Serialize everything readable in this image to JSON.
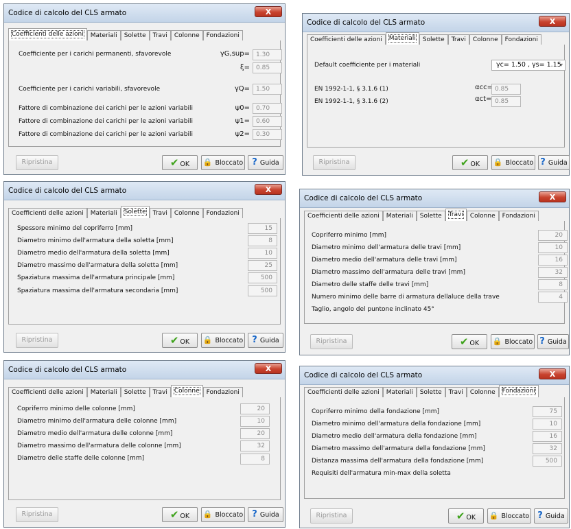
{
  "title": "Codice di calcolo del CLS armato",
  "tabs": [
    "Coefficienti delle azioni",
    "Materiali",
    "Solette",
    "Travi",
    "Colonne",
    "Fondazioni"
  ],
  "buttons": {
    "reset": "Ripristina",
    "ok": "OK",
    "locked": "Bloccato",
    "help": "Guida",
    "close": "X"
  },
  "azioni": {
    "rows": [
      {
        "label": "Coefficiente per i carichi permanenti, sfavorevole",
        "symbol": "γG,sup=",
        "value": "1.30"
      },
      {
        "label": "",
        "symbol": "ξ=",
        "value": "0.85"
      },
      {
        "label": "Coefficiente per i carichi variabili, sfavorevole",
        "symbol": "γQ=",
        "value": "1.50"
      },
      {
        "label": "Fattore di combinazione dei carichi per le azioni variabili",
        "symbol": "ψ0=",
        "value": "0.70"
      },
      {
        "label": "Fattore di combinazione dei carichi per le azioni variabili",
        "symbol": "ψ1=",
        "value": "0.60"
      },
      {
        "label": "Fattore di combinazione dei carichi per le azioni variabili",
        "symbol": "ψ2=",
        "value": "0.30"
      }
    ]
  },
  "materiali": {
    "default_label": "Default coefficiente per i materiali",
    "default_value": "γc= 1.50 , γs= 1.15",
    "rows": [
      {
        "label": "EN 1992-1-1, § 3.1.6 (1)",
        "symbol": "αcc=",
        "value": "0.85"
      },
      {
        "label": "EN 1992-1-1, § 3.1.6 (2)",
        "symbol": "αct=",
        "value": "0.85"
      }
    ]
  },
  "solette": {
    "rows": [
      {
        "label": "Spessore minimo del copriferro [mm]",
        "value": "15"
      },
      {
        "label": "Diametro minimo dell'armatura della soletta [mm]",
        "value": "8"
      },
      {
        "label": "Diametro medio dell'armatura della soletta [mm]",
        "value": "10"
      },
      {
        "label": "Diametro massimo dell'armatura della soletta [mm]",
        "value": "25"
      },
      {
        "label": "Spaziatura massima dell'armatura principale [mm]",
        "value": "500"
      },
      {
        "label": "Spaziatura massima dell'armatura secondaria [mm]",
        "value": "500"
      }
    ]
  },
  "travi": {
    "rows": [
      {
        "label": "Copriferro minimo [mm]",
        "value": "20"
      },
      {
        "label": "Diametro minimo dell'armatura delle travi [mm]",
        "value": "10"
      },
      {
        "label": "Diametro medio dell'armatura delle travi [mm]",
        "value": "16"
      },
      {
        "label": "Diametro massimo dell'armatura delle travi [mm]",
        "value": "32"
      },
      {
        "label": "Diametro delle staffe delle travi [mm]",
        "value": "8"
      },
      {
        "label": "Numero minimo delle barre di armatura dellaluce della trave",
        "value": "4"
      }
    ],
    "note": "Taglio, angolo del puntone inclinato 45°"
  },
  "colonne": {
    "rows": [
      {
        "label": "Copriferro minimo delle colonne [mm]",
        "value": "20"
      },
      {
        "label": "Diametro minimo dell'armatura delle colonne [mm]",
        "value": "10"
      },
      {
        "label": "Diametro medio dell'armatura delle colonne [mm]",
        "value": "20"
      },
      {
        "label": "Diametro massimo dell'armatura delle colonne [mm]",
        "value": "32"
      },
      {
        "label": "Diametro delle staffe delle colonne [mm]",
        "value": "8"
      }
    ]
  },
  "fondazioni": {
    "rows": [
      {
        "label": "Copriferro minimo della fondazione [mm]",
        "value": "75"
      },
      {
        "label": "Diametro minimo dell'armatura della fondazione [mm]",
        "value": "10"
      },
      {
        "label": "Diametro medio dell'armatura della fondazione [mm]",
        "value": "16"
      },
      {
        "label": "Diametro massimo dell'armatura della fondazione [mm]",
        "value": "32"
      },
      {
        "label": "Distanza massima dell'armatura della fondazione [mm]",
        "value": "500"
      }
    ],
    "note": "Requisiti dell'armatura min-max della soletta"
  }
}
